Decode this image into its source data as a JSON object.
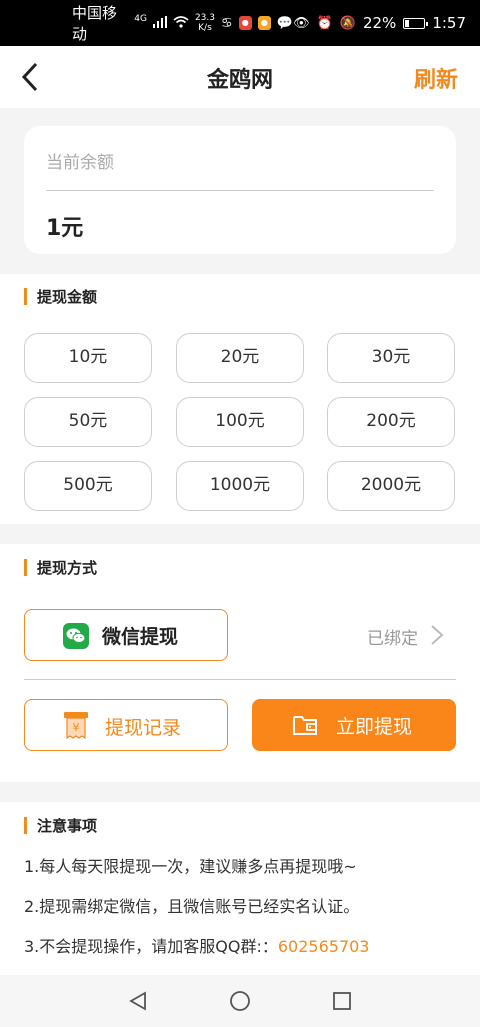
{
  "status_bar": {
    "carrier": "中国移动",
    "network": "4G",
    "speed_value": "23.3",
    "speed_unit": "K/s",
    "battery": "22%",
    "time": "1:57"
  },
  "header": {
    "title": "金鸥网",
    "refresh_label": "刷新"
  },
  "balance": {
    "label": "当前余额",
    "value": "1元"
  },
  "amount_section": {
    "title": "提现金额",
    "options": [
      "10元",
      "20元",
      "30元",
      "50元",
      "100元",
      "200元",
      "500元",
      "1000元",
      "2000元"
    ]
  },
  "method_section": {
    "title": "提现方式",
    "wechat_label": "微信提现",
    "bound_status": "已绑定",
    "record_label": "提现记录",
    "withdraw_label": "立即提现"
  },
  "notice_section": {
    "title": "注意事项",
    "items": [
      "1.每人每天限提现一次，建议赚多点再提现哦~",
      "2.提现需绑定微信，且微信账号已经实名认证。",
      "3.不会提现操作，请加客服QQ群:："
    ],
    "qq_group": "602565703"
  },
  "colors": {
    "accent": "#f28a1e",
    "primary_button": "#fa8518",
    "wechat_green": "#22a948"
  }
}
